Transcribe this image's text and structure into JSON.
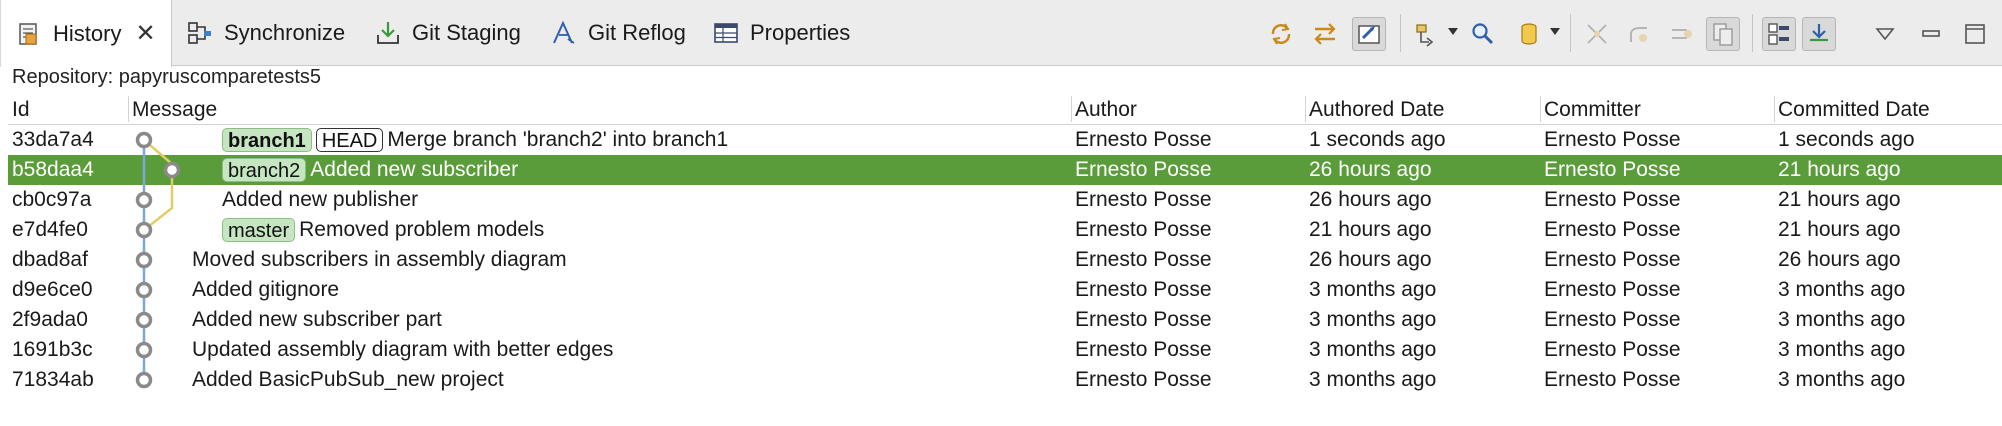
{
  "tabs": [
    {
      "label": "History",
      "icon": "history-icon",
      "active": true
    },
    {
      "label": "Synchronize",
      "icon": "synchronize-icon"
    },
    {
      "label": "Git Staging",
      "icon": "git-staging-icon"
    },
    {
      "label": "Git Reflog",
      "icon": "git-reflog-icon"
    },
    {
      "label": "Properties",
      "icon": "properties-icon"
    }
  ],
  "toolbar": [
    "link-with-selection-icon",
    "compare-mode-icon",
    "show-all-branches-icon",
    "filter-dropdown-icon",
    "find-icon",
    "repository-dropdown-icon",
    "show-first-parent-icon",
    "merge-icon",
    "rebase-icon",
    "show-changed-files-icon",
    "layout-toggle-icon",
    "show-comment-icon",
    "view-menu-icon",
    "minimize-icon",
    "maximize-icon"
  ],
  "repository": {
    "label": "Repository: papyruscomparetests5"
  },
  "columns": {
    "id": "Id",
    "message": "Message",
    "author": "Author",
    "authored_date": "Authored Date",
    "committer": "Committer",
    "committed_date": "Committed Date"
  },
  "commits": [
    {
      "id": "33da7a4",
      "refs": [
        {
          "name": "branch1",
          "type": "branch",
          "bold": true
        },
        {
          "name": "HEAD",
          "type": "head"
        }
      ],
      "message": "Merge branch 'branch2' into branch1",
      "author": "Ernesto Posse",
      "authored": "1 seconds ago",
      "committer": "Ernesto Posse",
      "committed": "1 seconds ago"
    },
    {
      "id": "b58daa4",
      "refs": [
        {
          "name": "branch2",
          "type": "branch"
        }
      ],
      "message": "Added new subscriber",
      "author": "Ernesto Posse",
      "authored": "26 hours ago",
      "committer": "Ernesto Posse",
      "committed": "21 hours ago",
      "selected": true
    },
    {
      "id": "cb0c97a",
      "refs": [],
      "message": "Added new publisher",
      "author": "Ernesto Posse",
      "authored": "26 hours ago",
      "committer": "Ernesto Posse",
      "committed": "21 hours ago"
    },
    {
      "id": "e7d4fe0",
      "refs": [
        {
          "name": "master",
          "type": "branch"
        }
      ],
      "message": "Removed problem models",
      "author": "Ernesto Posse",
      "authored": "21 hours ago",
      "committer": "Ernesto Posse",
      "committed": "21 hours ago"
    },
    {
      "id": "dbad8af",
      "refs": [],
      "message": "Moved subscribers in assembly diagram",
      "author": "Ernesto Posse",
      "authored": "26 hours ago",
      "committer": "Ernesto Posse",
      "committed": "26 hours ago"
    },
    {
      "id": "d9e6ce0",
      "refs": [],
      "message": "Added gitignore",
      "author": "Ernesto Posse",
      "authored": "3 months ago",
      "committer": "Ernesto Posse",
      "committed": "3 months ago"
    },
    {
      "id": "2f9ada0",
      "refs": [],
      "message": "Added new subscriber part",
      "author": "Ernesto Posse",
      "authored": "3 months ago",
      "committer": "Ernesto Posse",
      "committed": "3 months ago"
    },
    {
      "id": "1691b3c",
      "refs": [],
      "message": "Updated assembly diagram with better edges",
      "author": "Ernesto Posse",
      "authored": "3 months ago",
      "committer": "Ernesto Posse",
      "committed": "3 months ago"
    },
    {
      "id": "71834ab",
      "refs": [],
      "message": "Added BasicPubSub_new project",
      "author": "Ernesto Posse",
      "authored": "3 months ago",
      "committer": "Ernesto Posse",
      "committed": "3 months ago"
    }
  ],
  "colors": {
    "selection": "#5b9c3a",
    "branch_ref": "#c6e6c1",
    "graph_line_main": "#7fa6d9",
    "graph_line_branch": "#e2cc66",
    "node": "#8a8a8a"
  }
}
